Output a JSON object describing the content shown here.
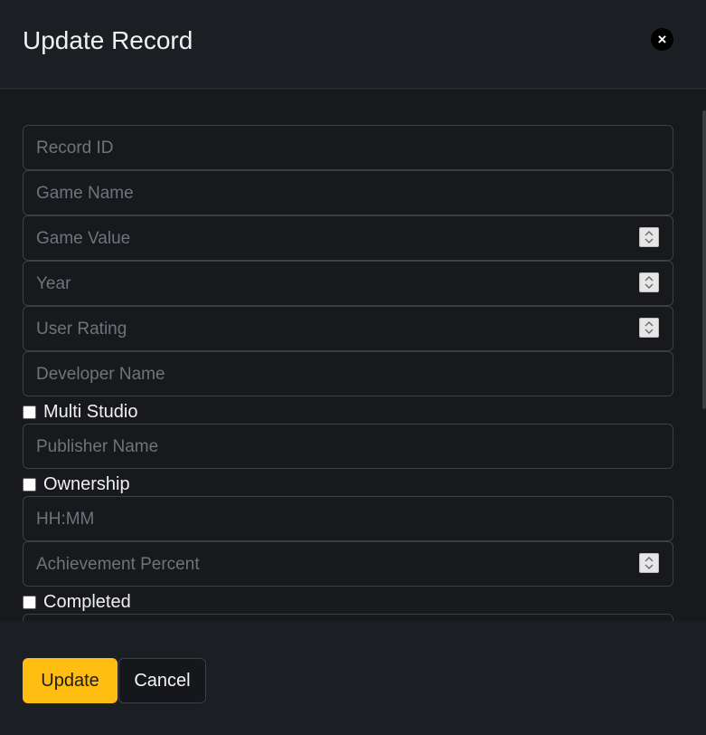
{
  "modal": {
    "title": "Update Record",
    "close_icon": "close-icon"
  },
  "form": {
    "record_id": {
      "placeholder": "Record ID"
    },
    "game_name": {
      "placeholder": "Game Name"
    },
    "game_value": {
      "placeholder": "Game Value"
    },
    "year": {
      "placeholder": "Year"
    },
    "user_rating": {
      "placeholder": "User Rating"
    },
    "developer_name": {
      "placeholder": "Developer Name"
    },
    "multi_studio": {
      "label": "Multi Studio",
      "checked": false
    },
    "publisher_name": {
      "placeholder": "Publisher Name"
    },
    "ownership": {
      "label": "Ownership",
      "checked": false
    },
    "playtime": {
      "placeholder": "HH:MM"
    },
    "achievement_percent": {
      "placeholder": "Achievement Percent"
    },
    "completed": {
      "label": "Completed",
      "checked": false
    }
  },
  "footer": {
    "update_label": "Update",
    "cancel_label": "Cancel"
  },
  "colors": {
    "background": "#17191d",
    "accent": "#ffbd12",
    "border": "#3b3f46",
    "placeholder": "#6f747b"
  }
}
